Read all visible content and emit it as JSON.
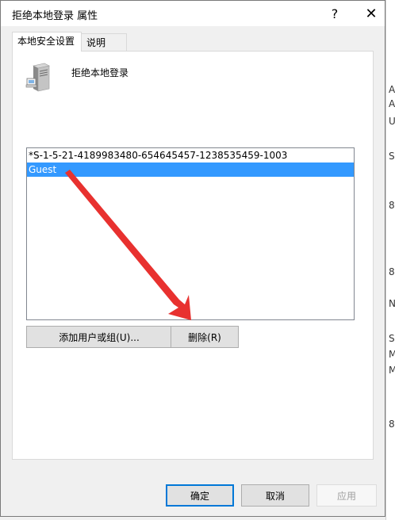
{
  "window": {
    "title": "拒绝本地登录 属性",
    "help_label": "?",
    "close_label": "✕"
  },
  "tabs": [
    {
      "label": "本地安全设置"
    },
    {
      "label": "说明"
    }
  ],
  "policy": {
    "icon": "server-icon",
    "name": "拒绝本地登录"
  },
  "accounts": [
    {
      "label": "*S-1-5-21-4189983480-654645457-1238535459-1003",
      "selected": false
    },
    {
      "label": "Guest",
      "selected": true
    }
  ],
  "buttons": {
    "add": "添加用户或组(U)...",
    "remove": "删除(R)",
    "ok": "确定",
    "cancel": "取消",
    "apply": "应用"
  },
  "annotation": {
    "type": "red-arrow",
    "color": "#e8312f"
  },
  "background_text": [
    "A",
    "A",
    "Us",
    "Sa",
    "8",
    "8",
    "NT",
    "S",
    "M",
    "M",
    "8"
  ],
  "colors": {
    "selection": "#3399ff",
    "focus_border": "#0078d7",
    "button_face": "#e1e1e1"
  }
}
